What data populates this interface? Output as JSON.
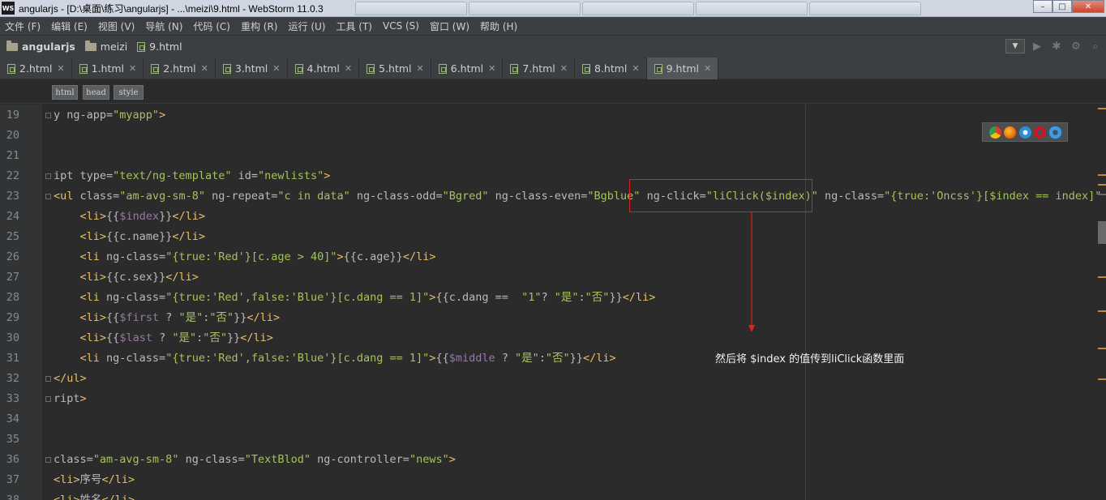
{
  "window": {
    "title": "angularjs - [D:\\桌面\\练习\\angularjs] - ...\\meizi\\9.html - WebStorm 11.0.3",
    "logo": "WS"
  },
  "menu": [
    "文件 (F)",
    "编辑 (E)",
    "视图 (V)",
    "导航 (N)",
    "代码 (C)",
    "重构 (R)",
    "运行 (U)",
    "工具 (T)",
    "VCS (S)",
    "窗口 (W)",
    "帮助 (H)"
  ],
  "breadcrumb": {
    "project": "angularjs",
    "folder": "meizi",
    "file": "9.html"
  },
  "tabs": [
    {
      "label": "2.html",
      "active": false
    },
    {
      "label": "1.html",
      "active": false
    },
    {
      "label": "2.html",
      "active": false
    },
    {
      "label": "3.html",
      "active": false
    },
    {
      "label": "4.html",
      "active": false
    },
    {
      "label": "5.html",
      "active": false
    },
    {
      "label": "6.html",
      "active": false
    },
    {
      "label": "7.html",
      "active": false
    },
    {
      "label": "8.html",
      "active": false
    },
    {
      "label": "9.html",
      "active": true
    }
  ],
  "tags": [
    "html",
    "head",
    "style"
  ],
  "lines": [
    {
      "num": "19",
      "text": "y ng-app=\"myapp\">"
    },
    {
      "num": "20",
      "text": ""
    },
    {
      "num": "21",
      "text": ""
    },
    {
      "num": "22",
      "text": "ipt type=\"text/ng-template\" id=\"newlists\">"
    },
    {
      "num": "23",
      "text": "<ul class=\"am-avg-sm-8\" ng-repeat=\"c in data\" ng-class-odd=\"Bgred\" ng-class-even=\"Bgblue\" ng-click=\"liClick($index)\" ng-class=\"{true:'Oncss'}[$index == index]\" >"
    },
    {
      "num": "24",
      "text": "    <li>{{$index}}</li>"
    },
    {
      "num": "25",
      "text": "    <li>{{c.name}}</li>"
    },
    {
      "num": "26",
      "text": "    <li ng-class=\"{true:'Red'}[c.age > 40]\">{{c.age}}</li>"
    },
    {
      "num": "27",
      "text": "    <li>{{c.sex}}</li>"
    },
    {
      "num": "28",
      "text": "    <li ng-class=\"{true:'Red',false:'Blue'}[c.dang == 1]\">{{c.dang ==  \"1\"? \"是\":\"否\"}}</li>"
    },
    {
      "num": "29",
      "text": "    <li>{{$first ? \"是\":\"否\"}}</li>"
    },
    {
      "num": "30",
      "text": "    <li>{{$last ? \"是\":\"否\"}}</li>"
    },
    {
      "num": "31",
      "text": "    <li ng-class=\"{true:'Red',false:'Blue'}[c.dang == 1]\">{{$middle ? \"是\":\"否\"}}</li>"
    },
    {
      "num": "32",
      "text": "</ul>"
    },
    {
      "num": "33",
      "text": "ript>"
    },
    {
      "num": "34",
      "text": ""
    },
    {
      "num": "35",
      "text": ""
    },
    {
      "num": "36",
      "text": "class=\"am-avg-sm-8\" ng-class=\"TextBlod\" ng-controller=\"news\">"
    },
    {
      "num": "37",
      "text": "<li>序号</li>"
    },
    {
      "num": "38",
      "text": "<li>姓名</li>"
    }
  ],
  "annotation": {
    "note": "然后将  $index 的值传到liClick函数里面",
    "color": "#e0201a"
  }
}
